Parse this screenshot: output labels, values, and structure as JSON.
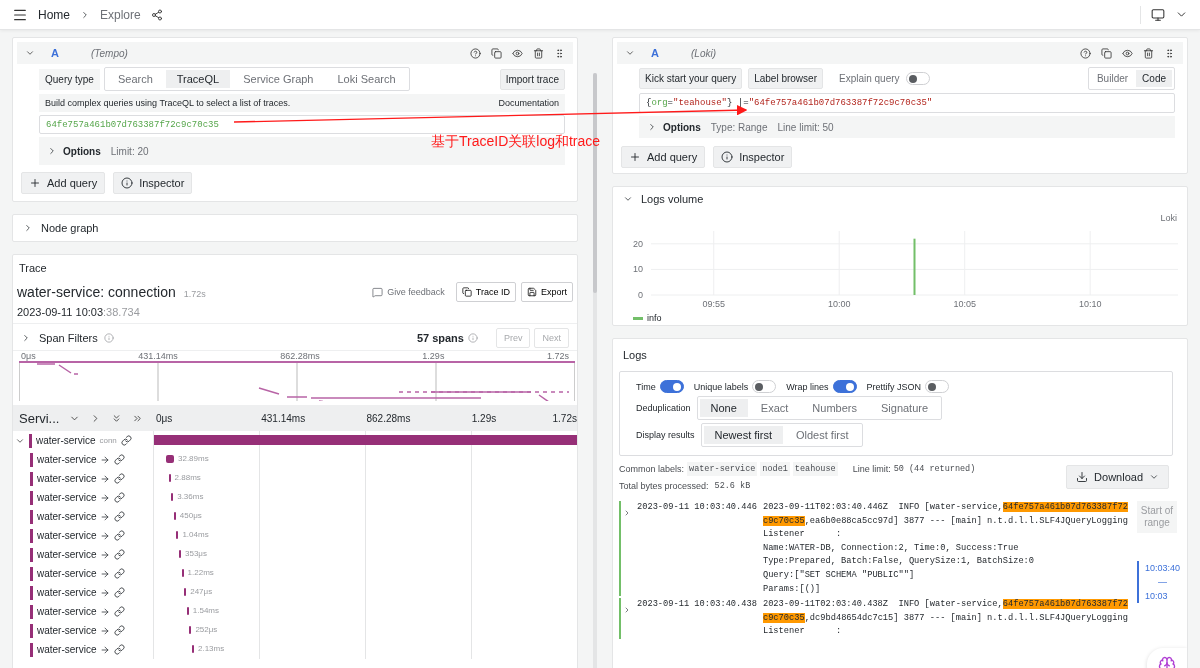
{
  "topbar": {
    "breadcrumbs": [
      {
        "label": "Home",
        "current": false
      },
      {
        "label": "Explore",
        "current": true
      }
    ]
  },
  "left": {
    "query": {
      "ref": "A",
      "datasource": "(Tempo)",
      "type_label": "Query type",
      "query_types": [
        {
          "label": "Search",
          "selected": false
        },
        {
          "label": "TraceQL",
          "selected": true
        },
        {
          "label": "Service Graph",
          "selected": false
        },
        {
          "label": "Loki Search",
          "selected": false
        }
      ],
      "import_button": "Import trace",
      "hint": "Build complex queries using TraceQL to select a list of traces.",
      "doc_link": "Documentation",
      "value": "64fe757a461b07d763387f72c9c70c35",
      "options": {
        "label": "Options",
        "expanded": false,
        "summary": [
          "Limit: 20"
        ]
      }
    },
    "actions": [
      {
        "kind": "add",
        "label": "Add query"
      },
      {
        "kind": "inspect",
        "label": "Inspector"
      }
    ],
    "node_graph": {
      "title": "Node graph",
      "expanded": false
    },
    "trace": {
      "panel_title": "Trace",
      "title": "water-service: connection",
      "duration": "1.72s",
      "start": "2023-09-11 10:03",
      "start_ms": ":38.734",
      "feedback": "Give feedback",
      "buttons": [
        {
          "kind": "trace_id",
          "label": "Trace ID"
        },
        {
          "kind": "export",
          "label": "Export"
        }
      ],
      "filters": {
        "label": "Span Filters",
        "expanded": false
      },
      "span_count": "57 spans",
      "nav": [
        {
          "label": "Prev",
          "disabled": true
        },
        {
          "label": "Next",
          "disabled": true
        }
      ],
      "minimap_ticks": [
        "0μs",
        "431.14ms",
        "862.28ms",
        "1.29s",
        "1.72s"
      ],
      "service_header": "Servi...",
      "header_ticks": [
        "0μs",
        "431.14ms",
        "862.28ms",
        "1.29s",
        "1.72s"
      ],
      "root": {
        "service": "water-service",
        "operation": "conn",
        "expanded": true,
        "children": [
          {
            "service": "water-service",
            "duration": "32.89ms"
          },
          {
            "service": "water-service",
            "duration": "2.88ms"
          },
          {
            "service": "water-service",
            "duration": "3.36ms"
          },
          {
            "service": "water-service",
            "duration": "450μs"
          },
          {
            "service": "water-service",
            "duration": "1.04ms"
          },
          {
            "service": "water-service",
            "duration": "353μs"
          },
          {
            "service": "water-service",
            "duration": "1.22ms"
          },
          {
            "service": "water-service",
            "duration": "247μs"
          },
          {
            "service": "water-service",
            "duration": "1.54ms"
          },
          {
            "service": "water-service",
            "duration": "252μs"
          },
          {
            "service": "water-service",
            "duration": "2.13ms"
          }
        ]
      }
    }
  },
  "right": {
    "query": {
      "ref": "A",
      "datasource": "(Loki)",
      "buttons": [
        "Kick start your query",
        "Label browser"
      ],
      "explain": {
        "label": "Explain query",
        "on": false
      },
      "modes": [
        {
          "label": "Builder",
          "selected": false
        },
        {
          "label": "Code",
          "selected": true
        }
      ],
      "tokens": [
        {
          "kind": "punct",
          "text": "{"
        },
        {
          "kind": "label",
          "text": "org"
        },
        {
          "kind": "punct",
          "text": "="
        },
        {
          "kind": "string",
          "text": "\"teahouse\""
        },
        {
          "kind": "punct",
          "text": "} |="
        },
        {
          "kind": "string",
          "text": "\"64fe757a461b07d763387f72c9c70c35\""
        }
      ],
      "options": {
        "label": "Options",
        "expanded": false,
        "summary": [
          "Type: Range",
          "Line limit: 50"
        ]
      }
    },
    "actions": [
      {
        "kind": "add",
        "label": "Add query"
      },
      {
        "kind": "inspect",
        "label": "Inspector"
      }
    ],
    "volume": {
      "title": "Logs volume",
      "expanded": true,
      "source": "Loki",
      "chart_data": {
        "type": "bar",
        "categories": [
          null,
          null,
          "09:55",
          null,
          null,
          null,
          null,
          "10:00",
          null,
          null,
          null,
          null,
          "10:05",
          null,
          null,
          null,
          null,
          "10:10",
          null,
          null,
          null
        ],
        "series": [
          {
            "name": "info",
            "color": "#73bf69",
            "values": [
              0,
              0,
              0,
              0,
              0,
              0,
              0,
              0,
              0,
              0,
              22,
              0,
              0,
              0,
              0,
              0,
              0,
              0,
              0,
              0,
              0
            ]
          }
        ],
        "ylim": [
          0,
          25
        ],
        "yticks": [
          0,
          10,
          20
        ],
        "grid": true
      }
    },
    "logs": {
      "title": "Logs",
      "toggles": [
        {
          "label": "Time",
          "on": true
        },
        {
          "label": "Unique labels",
          "on": false
        },
        {
          "label": "Wrap lines",
          "on": true
        },
        {
          "label": "Prettify JSON",
          "on": false
        }
      ],
      "dedup": {
        "label": "Deduplication",
        "options": [
          {
            "label": "None",
            "selected": true
          },
          {
            "label": "Exact",
            "selected": false
          },
          {
            "label": "Numbers",
            "selected": false
          },
          {
            "label": "Signature",
            "selected": false
          }
        ]
      },
      "order": {
        "label": "Display results",
        "options": [
          {
            "label": "Newest first",
            "selected": true
          },
          {
            "label": "Oldest first",
            "selected": false
          }
        ]
      },
      "common_labels_label": "Common labels:",
      "common_labels": [
        "water-service",
        "node1",
        "teahouse"
      ],
      "line_limit_label": "Line limit:",
      "line_limit": "50 (44 returned)",
      "download": "Download",
      "bytes_label": "Total bytes processed:",
      "bytes": "52.6 kB",
      "rows": [
        {
          "time": "2023-09-11 10:03:40.446",
          "segments": [
            {
              "text": "2023-09-11T02:03:40.446Z  INFO [water-service,",
              "highlight": false
            },
            {
              "text": "64fe757a461b07d763387f72c9c70c35",
              "highlight": true
            },
            {
              "text": ",ea6b0e88ca5cc97d] 3877 --- [main] n.t.d.l.l.SLF4JQueryLogging\nListener      :\nName:WATER-DB, Connection:2, Time:0, Success:True\nType:Prepared, Batch:False, QuerySize:1, BatchSize:0\nQuery:[\"SET SCHEMA \"PUBLIC\"\"]\nParams:[()]",
              "highlight": false
            }
          ]
        },
        {
          "time": "2023-09-11 10:03:40.438",
          "segments": [
            {
              "text": "2023-09-11T02:03:40.438Z  INFO [water-service,",
              "highlight": false
            },
            {
              "text": "64fe757a461b07d763387f72c9c70c35",
              "highlight": true
            },
            {
              "text": ",dc9bd48654dc7c15] 3877 --- [main] n.t.d.l.l.SLF4JQueryLogging\nListener      :",
              "highlight": false
            }
          ]
        }
      ],
      "range": {
        "start": "Start of range",
        "from": "10:03:40",
        "separator": "—",
        "to": "10:03"
      }
    }
  },
  "annotation": {
    "text": "基于TraceID关联log和trace"
  }
}
